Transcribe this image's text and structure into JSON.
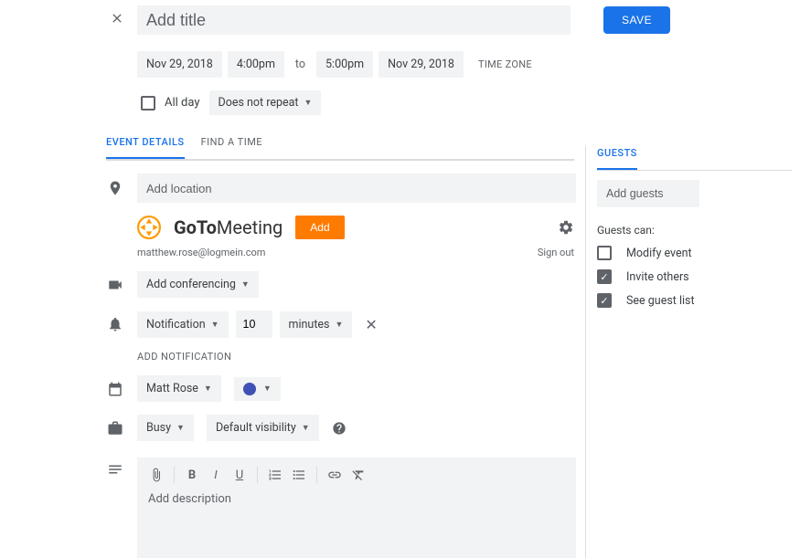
{
  "header": {
    "title_placeholder": "Add title",
    "save_label": "SAVE"
  },
  "datetime": {
    "start_date": "Nov 29, 2018",
    "start_time": "4:00pm",
    "to": "to",
    "end_time": "5:00pm",
    "end_date": "Nov 29, 2018",
    "timezone_label": "TIME ZONE"
  },
  "options": {
    "all_day_label": "All day",
    "all_day_checked": false,
    "repeat_label": "Does not repeat"
  },
  "tabs": {
    "event_details": "EVENT DETAILS",
    "find_time": "FIND A TIME",
    "guests": "GUESTS"
  },
  "location": {
    "placeholder": "Add location"
  },
  "gotomeeting": {
    "brand_a": "GoTo",
    "brand_b": "Meeting",
    "add_label": "Add",
    "email": "matthew.rose@logmein.com",
    "signout": "Sign out"
  },
  "conferencing": {
    "label": "Add conferencing"
  },
  "notification": {
    "type": "Notification",
    "value": "10",
    "unit": "minutes",
    "add_label": "ADD NOTIFICATION"
  },
  "calendar": {
    "owner": "Matt Rose",
    "color": "#3f51b5"
  },
  "visibility": {
    "busy": "Busy",
    "default": "Default visibility"
  },
  "description": {
    "placeholder": "Add description"
  },
  "guests": {
    "placeholder": "Add guests",
    "can_label": "Guests can:",
    "modify": {
      "label": "Modify event",
      "checked": false
    },
    "invite": {
      "label": "Invite others",
      "checked": true
    },
    "seelist": {
      "label": "See guest list",
      "checked": true
    }
  }
}
